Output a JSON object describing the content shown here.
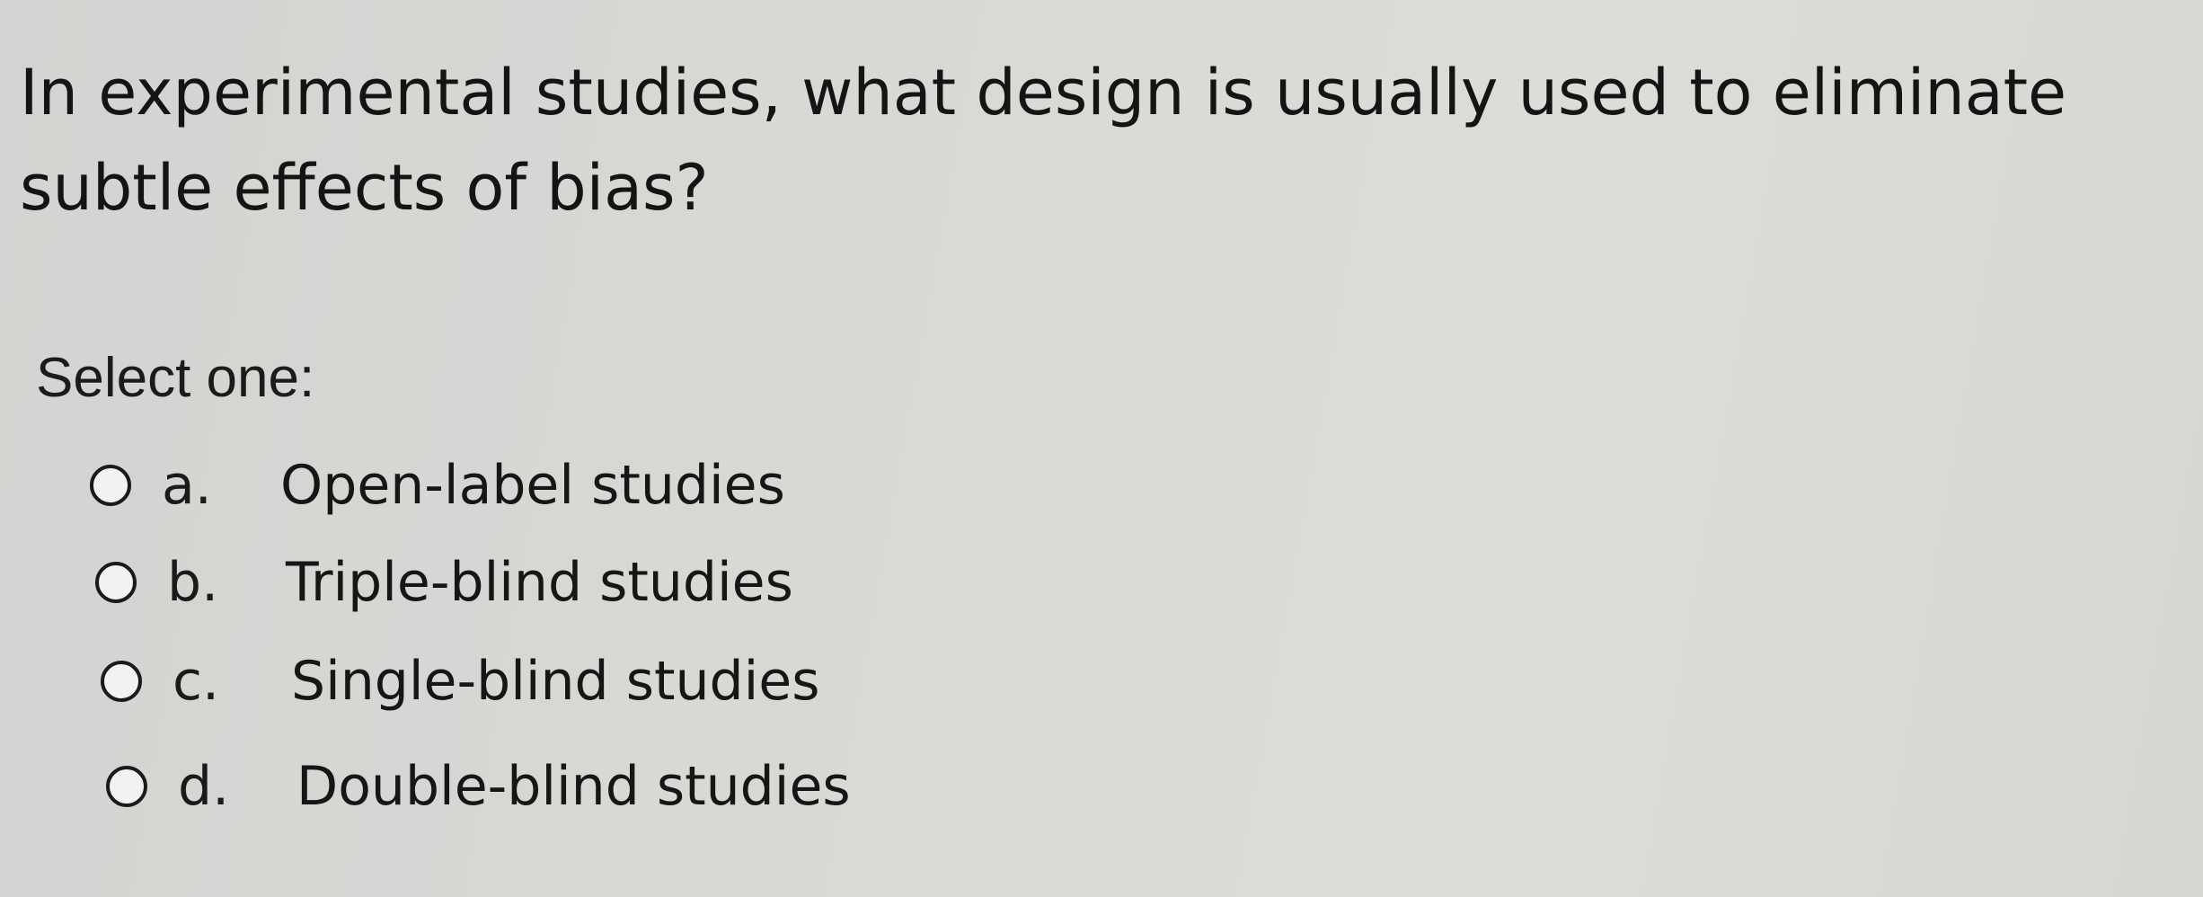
{
  "quiz": {
    "question": "In experimental studies, what design is usually used to eliminate subtle effects of bias?",
    "prompt": "Select one:",
    "options": [
      {
        "letter": "a.",
        "text": "Open-label studies"
      },
      {
        "letter": "b.",
        "text": "Triple-blind studies"
      },
      {
        "letter": "c.",
        "text": "Single-blind studies"
      },
      {
        "letter": "d.",
        "text": "Double-blind studies"
      }
    ]
  }
}
